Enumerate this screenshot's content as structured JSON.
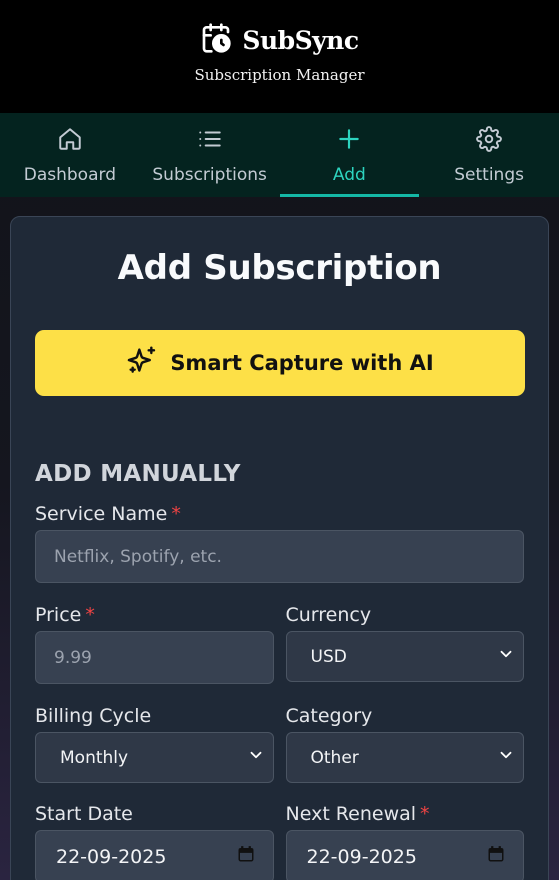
{
  "app": {
    "name": "SubSync",
    "subtitle": "Subscription Manager",
    "icon": "calendar-clock-icon"
  },
  "nav": {
    "tabs": [
      {
        "label": "Dashboard",
        "icon": "home-icon"
      },
      {
        "label": "Subscriptions",
        "icon": "list-icon"
      },
      {
        "label": "Add",
        "icon": "plus-icon",
        "active": true
      },
      {
        "label": "Settings",
        "icon": "gear-icon"
      }
    ]
  },
  "form": {
    "title": "Add Subscription",
    "ai_button": {
      "label": "Smart Capture with AI",
      "icon": "sparkles-icon"
    },
    "section_label": "ADD MANUALLY",
    "required_marker": "*",
    "service_name": {
      "label": "Service Name",
      "placeholder": "Netflix, Spotify, etc."
    },
    "price": {
      "label": "Price",
      "placeholder": "9.99"
    },
    "currency": {
      "label": "Currency",
      "value": "USD"
    },
    "billing_cycle": {
      "label": "Billing Cycle",
      "value": "Monthly"
    },
    "category": {
      "label": "Category",
      "value": "Other"
    },
    "start_date": {
      "label": "Start Date",
      "value": "22-09-2025"
    },
    "next_renewal": {
      "label": "Next Renewal",
      "value": "22-09-2025"
    }
  },
  "colors": {
    "accent": "#14b8a6",
    "ai_button": "#fde047",
    "required": "#ef4444",
    "card": "#1f2937"
  }
}
